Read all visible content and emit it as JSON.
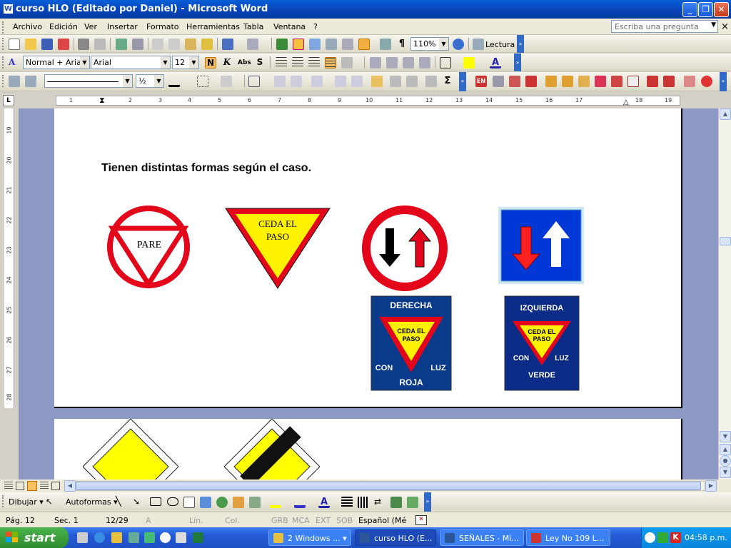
{
  "window": {
    "title": "curso HLO (Editado por Daniel) - Microsoft Word",
    "app_icon": "W"
  },
  "menu": {
    "items": [
      "Archivo",
      "Edición",
      "Ver",
      "Insertar",
      "Formato",
      "Herramientas",
      "Tabla",
      "Ventana",
      "?"
    ],
    "help_placeholder": "Escriba una pregunta"
  },
  "toolbar_standard": {
    "zoom": "110%",
    "reading_label": "Lectura"
  },
  "toolbar_format": {
    "style": "Normal + Arial,",
    "font": "Arial",
    "size": "12",
    "bold": "N",
    "italic": "K",
    "smallcaps": "Abs",
    "strike": "S"
  },
  "toolbar_draw": {
    "line_weight": "½"
  },
  "ruler": {
    "h_ticks": [
      "1",
      "2",
      "3",
      "4",
      "5",
      "6",
      "7",
      "8",
      "9",
      "10",
      "11",
      "12",
      "13",
      "14",
      "15",
      "16",
      "17",
      "18",
      "19"
    ],
    "v_ticks": [
      "19",
      "20",
      "21",
      "22",
      "23",
      "24",
      "25",
      "26",
      "27",
      "28"
    ],
    "tab_marker": "L"
  },
  "document": {
    "heading": "Tienen distintas formas según el caso.",
    "signs": {
      "pare": "PARE",
      "ceda_line1": "CEDA EL",
      "ceda_line2": "PASO",
      "derecha_top": "DERECHA",
      "derecha_ceda1": "CEDA EL",
      "derecha_ceda2": "PASO",
      "derecha_con": "CON",
      "derecha_luz": "LUZ",
      "derecha_bottom": "ROJA",
      "izquierda_top": "IZQUIERDA",
      "izquierda_ceda1": "CEDA EL",
      "izquierda_ceda2": "PASO",
      "izquierda_con": "CON",
      "izquierda_luz": "LUZ",
      "izquierda_bottom": "VERDE"
    }
  },
  "drawing_toolbar": {
    "draw": "Dibujar",
    "autoshapes": "Autoformas"
  },
  "status": {
    "page": "Pág.  12",
    "section": "Sec.  1",
    "pages": "12/29",
    "at": "A",
    "line": "Lín.",
    "col": "Col.",
    "grb": "GRB",
    "mca": "MCA",
    "ext": "EXT",
    "sob": "SOB",
    "language": "Español (Mé"
  },
  "taskbar": {
    "start": "start",
    "tasks": [
      "2 Windows ...",
      "curso HLO (E...",
      "SEÑALES - Mi...",
      "Ley No 109 L..."
    ],
    "clock": "04:58 p.m."
  },
  "colors": {
    "sign_red": "#e3061a",
    "sign_yellow": "#fff200",
    "sign_blue": "#0038a8",
    "xp_blue": "#245edb"
  }
}
